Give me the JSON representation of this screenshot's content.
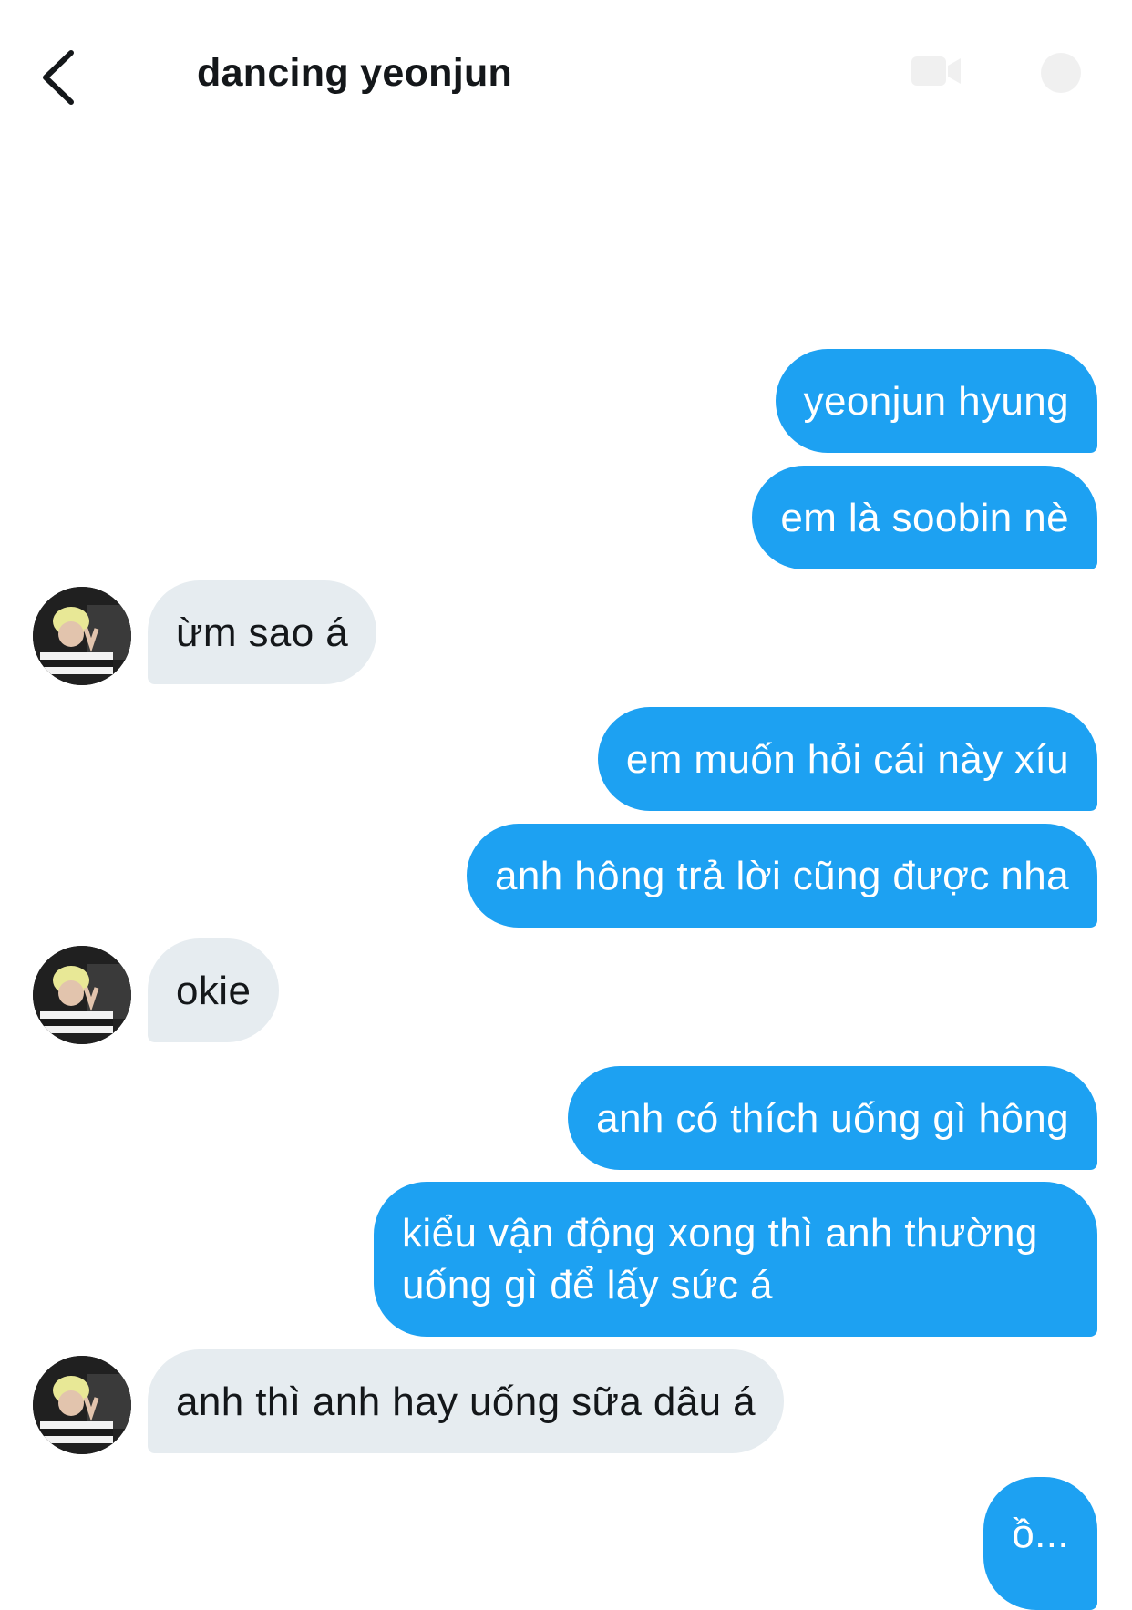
{
  "header": {
    "title": "dancing yeonjun",
    "back_icon": "chevron-left-icon",
    "video_icon": "video-icon",
    "info_icon": "info-icon"
  },
  "messages": [
    {
      "direction": "outgoing",
      "text": "yeonjun hyung"
    },
    {
      "direction": "outgoing",
      "text": "em là soobin nè"
    },
    {
      "direction": "incoming",
      "text": "ừm sao á"
    },
    {
      "direction": "outgoing",
      "text": "em muốn hỏi cái này xíu"
    },
    {
      "direction": "outgoing",
      "text": "anh hông trả lời cũng được nha"
    },
    {
      "direction": "incoming",
      "text": "okie"
    },
    {
      "direction": "outgoing",
      "text": "anh có thích uống gì hông"
    },
    {
      "direction": "outgoing",
      "text": "kiểu vận động xong thì anh thường uống gì để lấy sức á"
    },
    {
      "direction": "incoming",
      "text": "anh thì anh hay uống sữa dâu á"
    },
    {
      "direction": "outgoing",
      "text": "ồ..."
    }
  ],
  "colors": {
    "outgoing_bubble": "#1da1f2",
    "incoming_bubble": "#e6ecf0",
    "title_text": "#14171a"
  }
}
